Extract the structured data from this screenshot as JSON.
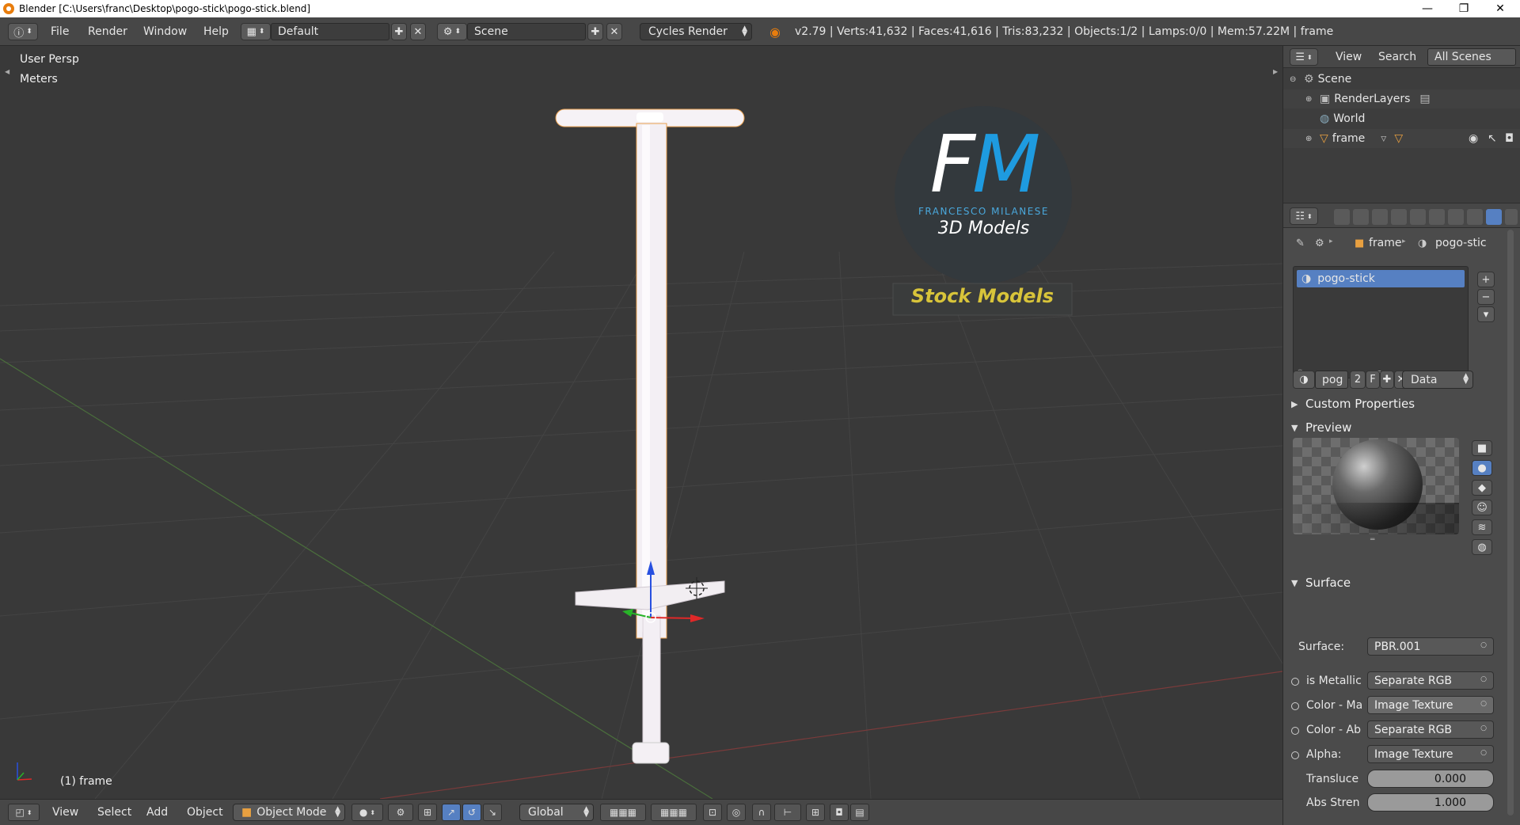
{
  "window": {
    "title": "Blender [C:\\Users\\franc\\Desktop\\pogo-stick\\pogo-stick.blend]",
    "controls": [
      "—",
      "❐",
      "✕"
    ]
  },
  "info_header": {
    "menus": [
      "File",
      "Render",
      "Window",
      "Help"
    ],
    "screen_layout": "Default",
    "scene": "Scene",
    "render_engine": "Cycles Render",
    "stats": "v2.79 | Verts:41,632 | Faces:41,616 | Tris:83,232 | Objects:1/2 | Lamps:0/0 | Mem:57.22M | frame"
  },
  "viewport": {
    "view_name": "User Persp",
    "units": "Meters",
    "object_label": "(1) frame",
    "logo": {
      "initials": "FM",
      "name": "FRANCESCO MILANESE",
      "subtitle": "3D Models",
      "banner": "Stock Models"
    }
  },
  "viewport_header": {
    "menus": [
      "View",
      "Select",
      "Add",
      "Object"
    ],
    "mode": "Object Mode",
    "orientation": "Global"
  },
  "outliner": {
    "header_menus": [
      "View",
      "Search"
    ],
    "filter": "All Scenes",
    "items": [
      {
        "label": "Scene",
        "indent": 0
      },
      {
        "label": "RenderLayers",
        "indent": 1
      },
      {
        "label": "World",
        "indent": 1
      },
      {
        "label": "frame",
        "indent": 1
      }
    ]
  },
  "properties": {
    "breadcrumb": {
      "object": "frame",
      "material": "pogo-stic"
    },
    "material_slot": "pogo-stick",
    "datablock": {
      "name": "pog",
      "users": "2",
      "fake": "F",
      "link": "Data"
    },
    "panels": {
      "custom_properties": "Custom Properties",
      "preview": "Preview",
      "surface": "Surface"
    },
    "surface": {
      "label": "Surface:",
      "value": "PBR.001",
      "inputs": [
        {
          "label": "is Metallic",
          "value": "Separate RGB"
        },
        {
          "label": "Color - Ma",
          "value": "Image Texture"
        },
        {
          "label": "Color - Ab",
          "value": "Separate RGB"
        },
        {
          "label": "Alpha:",
          "value": "Image Texture"
        }
      ],
      "translucency": {
        "label": "Transluce",
        "value": "0.000"
      },
      "abs_strength": {
        "label": "Abs Stren",
        "value": "1.000"
      }
    }
  }
}
